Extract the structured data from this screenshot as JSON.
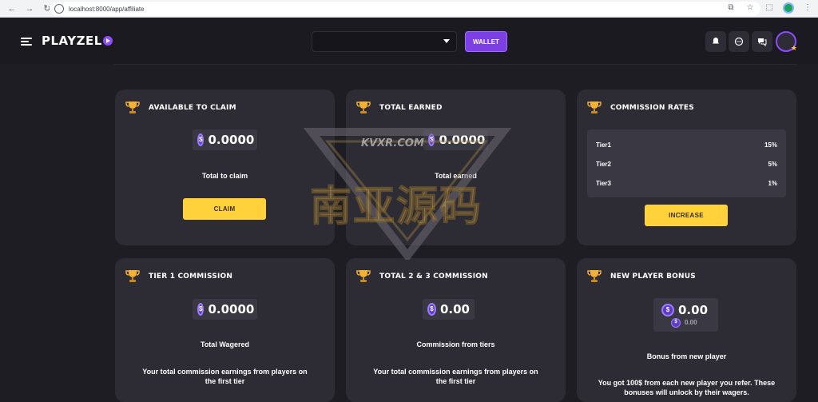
{
  "browser": {
    "url": "localhost:8000/app/affiliate"
  },
  "header": {
    "logo_text": "PLAYZEL",
    "wallet_label": "WALLET",
    "selector_value": "",
    "brand_color": "#7b3fe4"
  },
  "cards": {
    "available_to_claim": {
      "title": "AVAILABLE TO CLAIM",
      "amount": "0.0000",
      "label": "Total to claim",
      "button": "CLAIM"
    },
    "total_earned": {
      "title": "TOTAL EARNED",
      "amount": "0.0000",
      "label": "Total earned"
    },
    "commission_rates": {
      "title": "COMMISSION RATES",
      "rates": [
        {
          "tier": "Tier1",
          "rate": "15%"
        },
        {
          "tier": "Tier2",
          "rate": "5%"
        },
        {
          "tier": "Tier3",
          "rate": "1%"
        }
      ],
      "button": "INCREASE"
    },
    "tier1_commission": {
      "title": "TIER 1 COMMISSION",
      "amount": "0.0000",
      "label": "Total Wagered",
      "desc": "Your total commission earnings from players on the first tier"
    },
    "total_2_3_commission": {
      "title": "TOTAL 2 & 3 COMMISSION",
      "amount": "0.00",
      "label": "Commission from tiers",
      "desc": "Your total commission earnings from players on the first tier"
    },
    "new_player_bonus": {
      "title": "NEW PLAYER BONUS",
      "amount": "0.00",
      "sub_amount": "0.00",
      "label": "Bonus from new player",
      "desc": "You got 100$ from each new player you refer. These bonuses will unlock by their wagers."
    }
  },
  "watermark": {
    "small": "KVXR.COM",
    "large": "南亚源码"
  }
}
